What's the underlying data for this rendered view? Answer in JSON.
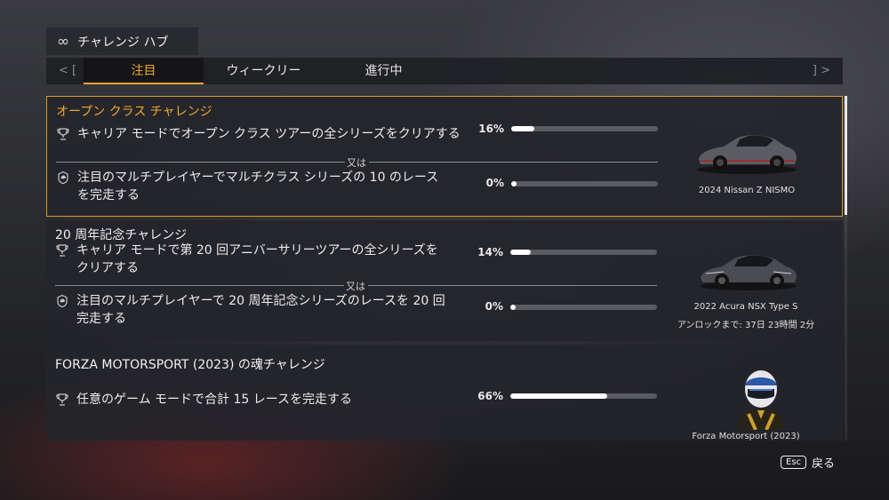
{
  "header": {
    "title": "チャレンジ ハブ",
    "icon": "infinity-icon"
  },
  "tabs": {
    "nav_left": "< [",
    "nav_right": "] >",
    "items": [
      {
        "label": "注目",
        "active": true
      },
      {
        "label": "ウィークリー",
        "active": false
      },
      {
        "label": "進行中",
        "active": false
      }
    ]
  },
  "challenges": [
    {
      "title": "オープン クラス チャレンジ",
      "selected": true,
      "objectives": [
        {
          "icon": "trophy-icon",
          "text": "キャリア モードでオープン クラス ツアーの全シリーズをクリアする",
          "percent_label": "16%",
          "progress": 0.16
        },
        {
          "icon": "helmet-badge-icon",
          "text": "注目のマルチプレイヤーでマルチクラス シリーズの 10 のレースを完走する",
          "percent_label": "0%",
          "progress": 0.0
        }
      ],
      "separator": "又は",
      "reward": {
        "name": "2024 Nissan Z NISMO",
        "unlock": ""
      }
    },
    {
      "title": "20 周年記念チャレンジ",
      "selected": false,
      "objectives": [
        {
          "icon": "trophy-icon",
          "text": "キャリア モードで第 20 回アニバーサリーツアーの全シリーズをクリアする",
          "percent_label": "14%",
          "progress": 0.14
        },
        {
          "icon": "helmet-badge-icon",
          "text": "注目のマルチプレイヤーで 20 周年記念シリーズのレースを 20 回完走する",
          "percent_label": "0%",
          "progress": 0.0
        }
      ],
      "separator": "又は",
      "reward": {
        "name": "2022 Acura NSX Type S",
        "unlock": "アンロックまで: 37日 23時間 2分"
      }
    },
    {
      "title": "FORZA MOTORSPORT (2023) の魂チャレンジ",
      "selected": false,
      "objectives": [
        {
          "icon": "trophy-icon",
          "text": "任意のゲーム モードで合計 15 レースを完走する",
          "percent_label": "66%",
          "progress": 0.66
        }
      ],
      "reward": {
        "name": "Forza Motorsport (2023)",
        "unlock": ""
      }
    }
  ],
  "footer": {
    "key": "Esc",
    "label": "戻る"
  },
  "colors": {
    "accent": "#f0a830",
    "bar_bg": "#5a5b60",
    "bar_fill": "#ffffff"
  }
}
